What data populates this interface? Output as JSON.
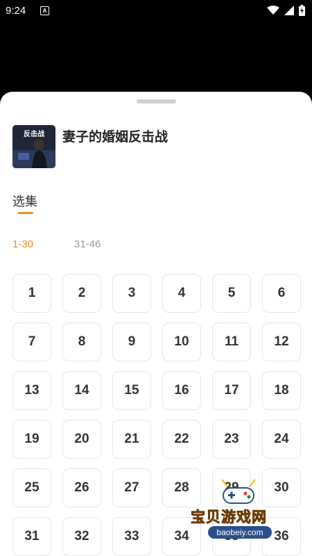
{
  "status_bar": {
    "time": "9:24",
    "notification_badge": "A"
  },
  "sheet": {
    "drama_title": "妻子的婚姻反击战",
    "cover_text": "反击战",
    "section_tab": "选集",
    "ranges": [
      "1-30",
      "31-46"
    ],
    "active_range": "1-30",
    "episodes": [
      "1",
      "2",
      "3",
      "4",
      "5",
      "6",
      "7",
      "8",
      "9",
      "10",
      "11",
      "12",
      "13",
      "14",
      "15",
      "16",
      "17",
      "18",
      "19",
      "20",
      "21",
      "22",
      "23",
      "24",
      "25",
      "26",
      "27",
      "28",
      "29",
      "30",
      "31",
      "32",
      "33",
      "34",
      "35",
      "36"
    ]
  },
  "watermark": {
    "brand": "宝贝游戏网",
    "url": "baobeiy.com"
  },
  "colors": {
    "accent": "#f08a1c",
    "inactive": "#999999",
    "border": "#e6e6e6"
  }
}
